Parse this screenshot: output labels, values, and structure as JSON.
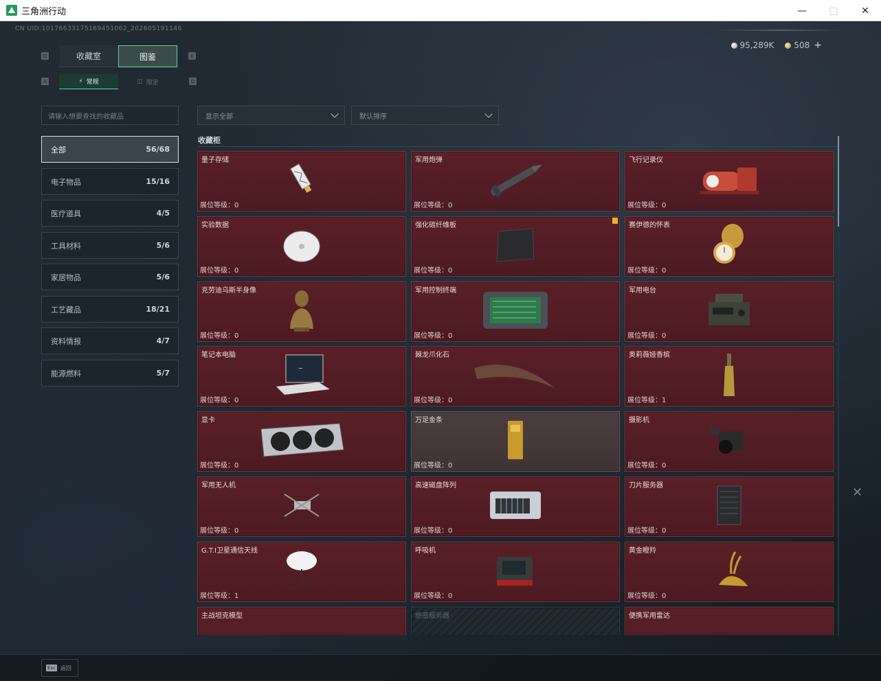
{
  "window": {
    "title": "三角洲行动"
  },
  "game": {
    "uid": "CN UID:10176633175169451062_2026051911​46",
    "currency": [
      {
        "icon": "silver-coin-icon",
        "value": "95,289K"
      },
      {
        "icon": "gold-coin-icon",
        "value": "508"
      }
    ],
    "tabs": [
      {
        "label": "收藏室"
      },
      {
        "label": "图鉴"
      }
    ],
    "subtabs": [
      {
        "label": "常规"
      },
      {
        "label": "限定"
      }
    ],
    "key_hints": {
      "q": "Q",
      "e": "E",
      "a": "A",
      "d": "D"
    },
    "search": {
      "placeholder": "请输入想要查找的收藏品"
    },
    "filters": {
      "display": "显示全部",
      "sort": "默认排序"
    },
    "categories": [
      {
        "label": "全部",
        "count": "56/68"
      },
      {
        "label": "电子物品",
        "count": "15/16"
      },
      {
        "label": "医疗道具",
        "count": "4/5"
      },
      {
        "label": "工具材料",
        "count": "5/6"
      },
      {
        "label": "家居物品",
        "count": "5/6"
      },
      {
        "label": "工艺藏品",
        "count": "18/21"
      },
      {
        "label": "资料情报",
        "count": "4/7"
      },
      {
        "label": "能源燃料",
        "count": "5/7"
      }
    ],
    "section_title": "收藏柜",
    "level_prefix": "展位等级：",
    "items": [
      {
        "name": "量子存储",
        "level": "0",
        "icon": "usb-drive-icon"
      },
      {
        "name": "军用炮弹",
        "level": "0",
        "icon": "artillery-shell-icon"
      },
      {
        "name": "飞行记录仪",
        "level": "0",
        "icon": "flight-recorder-icon"
      },
      {
        "name": "实验数据",
        "level": "0",
        "icon": "disc-icon"
      },
      {
        "name": "强化碳纤维板",
        "level": "0",
        "icon": "carbon-plate-icon"
      },
      {
        "name": "赛伊德的怀表",
        "level": "0",
        "icon": "pocket-watch-icon"
      },
      {
        "name": "克劳迪乌斯半身像",
        "level": "0",
        "icon": "bust-icon"
      },
      {
        "name": "军用控制终端",
        "level": "0",
        "icon": "control-terminal-icon"
      },
      {
        "name": "军用电台",
        "level": "0",
        "icon": "radio-icon"
      },
      {
        "name": "笔记本电脑",
        "level": "0",
        "icon": "laptop-icon"
      },
      {
        "name": "棘龙爪化石",
        "level": "0",
        "icon": "claw-fossil-icon"
      },
      {
        "name": "奥莉薇娅香槟",
        "level": "1",
        "icon": "champagne-icon"
      },
      {
        "name": "显卡",
        "level": "0",
        "icon": "graphics-card-icon"
      },
      {
        "name": "万足金条",
        "level": "0",
        "icon": "gold-bar-icon"
      },
      {
        "name": "摄影机",
        "level": "0",
        "icon": "camera-icon"
      },
      {
        "name": "军用无人机",
        "level": "0",
        "icon": "drone-icon"
      },
      {
        "name": "高速磁盘阵列",
        "level": "0",
        "icon": "disk-array-icon"
      },
      {
        "name": "刀片服务器",
        "level": "0",
        "icon": "blade-server-icon"
      },
      {
        "name": "G.T.I卫星通信天线",
        "level": "1",
        "icon": "satellite-dish-icon"
      },
      {
        "name": "呼吸机",
        "level": "0",
        "icon": "ventilator-icon"
      },
      {
        "name": "黄金瞪羚",
        "level": "0",
        "icon": "gold-gazelle-icon"
      },
      {
        "name": "主战坦克模型",
        "level": "",
        "icon": "tank-model-icon"
      },
      {
        "name": "绝密服务器",
        "level": "",
        "icon": "locked-icon"
      },
      {
        "name": "便携军用雷达",
        "level": "",
        "icon": "radar-icon"
      }
    ],
    "footer": {
      "esc_key": "Esc",
      "back_label": "返回"
    }
  }
}
